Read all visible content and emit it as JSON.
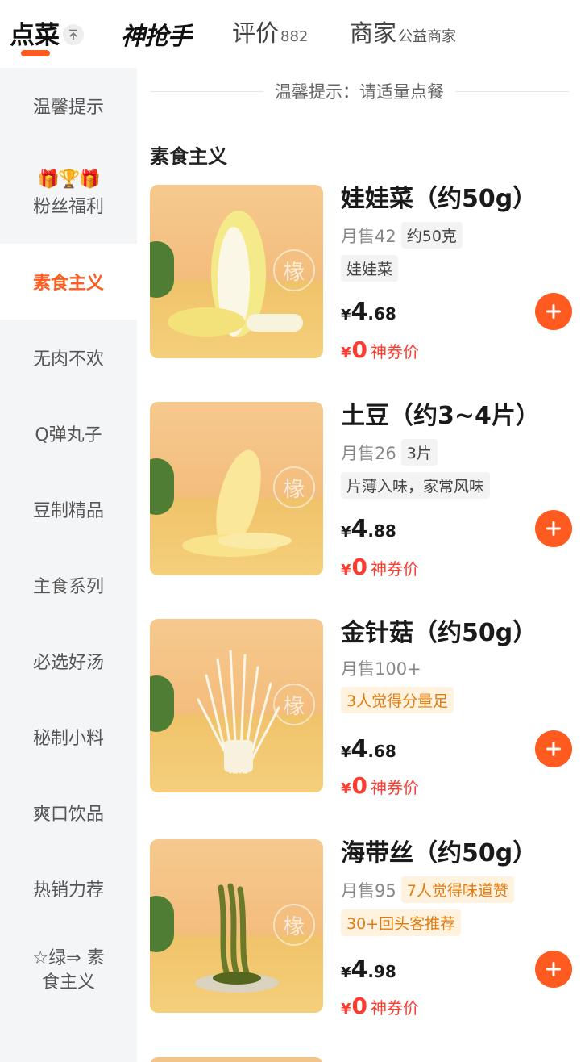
{
  "tabs": {
    "order": "点菜",
    "pin_glyph": "⤒",
    "brand": "神抢手",
    "review": "评价",
    "review_count": "882",
    "merchant": "商家",
    "merchant_tag": "公益商家"
  },
  "accent_color": "#ff5a1f",
  "coupon_color": "#ff3b30",
  "sidebar": {
    "items": [
      {
        "label": "温馨提示"
      },
      {
        "label": "粉丝福利",
        "emoji": "🎁🏆🎁"
      },
      {
        "label": "素食主义",
        "active": true
      },
      {
        "label": "无肉不欢"
      },
      {
        "label": "Q弹丸子"
      },
      {
        "label": "豆制精品"
      },
      {
        "label": "主食系列"
      },
      {
        "label": "必选好汤"
      },
      {
        "label": "秘制小料"
      },
      {
        "label": "爽口饮品"
      },
      {
        "label": "热销力荐"
      },
      {
        "label_line1": "☆绿⇒ 素",
        "label_line2": "食主义"
      }
    ]
  },
  "tip": "温馨提示：请适量点餐",
  "section_title": "素食主义",
  "items": [
    {
      "name": "娃娃菜（约50g）",
      "sales": "月售42",
      "tags": [
        "约50克"
      ],
      "tags2": [
        "娃娃菜"
      ],
      "currency": "¥",
      "price_int": "4",
      "price_dec": ".68",
      "coupon_price": "0",
      "coupon_label": "神券价",
      "watermark": "椽",
      "image_icon": "napa-cabbage-image"
    },
    {
      "name": "土豆（约3~4片）",
      "sales": "月售26",
      "tags": [
        "3片"
      ],
      "tags2": [
        "片薄入味，家常风味"
      ],
      "currency": "¥",
      "price_int": "4",
      "price_dec": ".88",
      "coupon_price": "0",
      "coupon_label": "神券价",
      "watermark": "椽",
      "image_icon": "potato-slices-image"
    },
    {
      "name": "金针菇（约50g）",
      "sales": "月售100+",
      "tags": [],
      "hot_tags2": [
        "3人觉得分量足"
      ],
      "currency": "¥",
      "price_int": "4",
      "price_dec": ".68",
      "coupon_price": "0",
      "coupon_label": "神券价",
      "watermark": "椽",
      "image_icon": "enoki-mushroom-image"
    },
    {
      "name": "海带丝（约50g）",
      "sales": "月售95",
      "hot_tags": [
        "7人觉得味道赞"
      ],
      "hot_tags2": [
        "30+回头客推荐"
      ],
      "currency": "¥",
      "price_int": "4",
      "price_dec": ".98",
      "coupon_price": "0",
      "coupon_label": "神券价",
      "watermark": "椽",
      "image_icon": "kelp-shreds-image"
    }
  ]
}
